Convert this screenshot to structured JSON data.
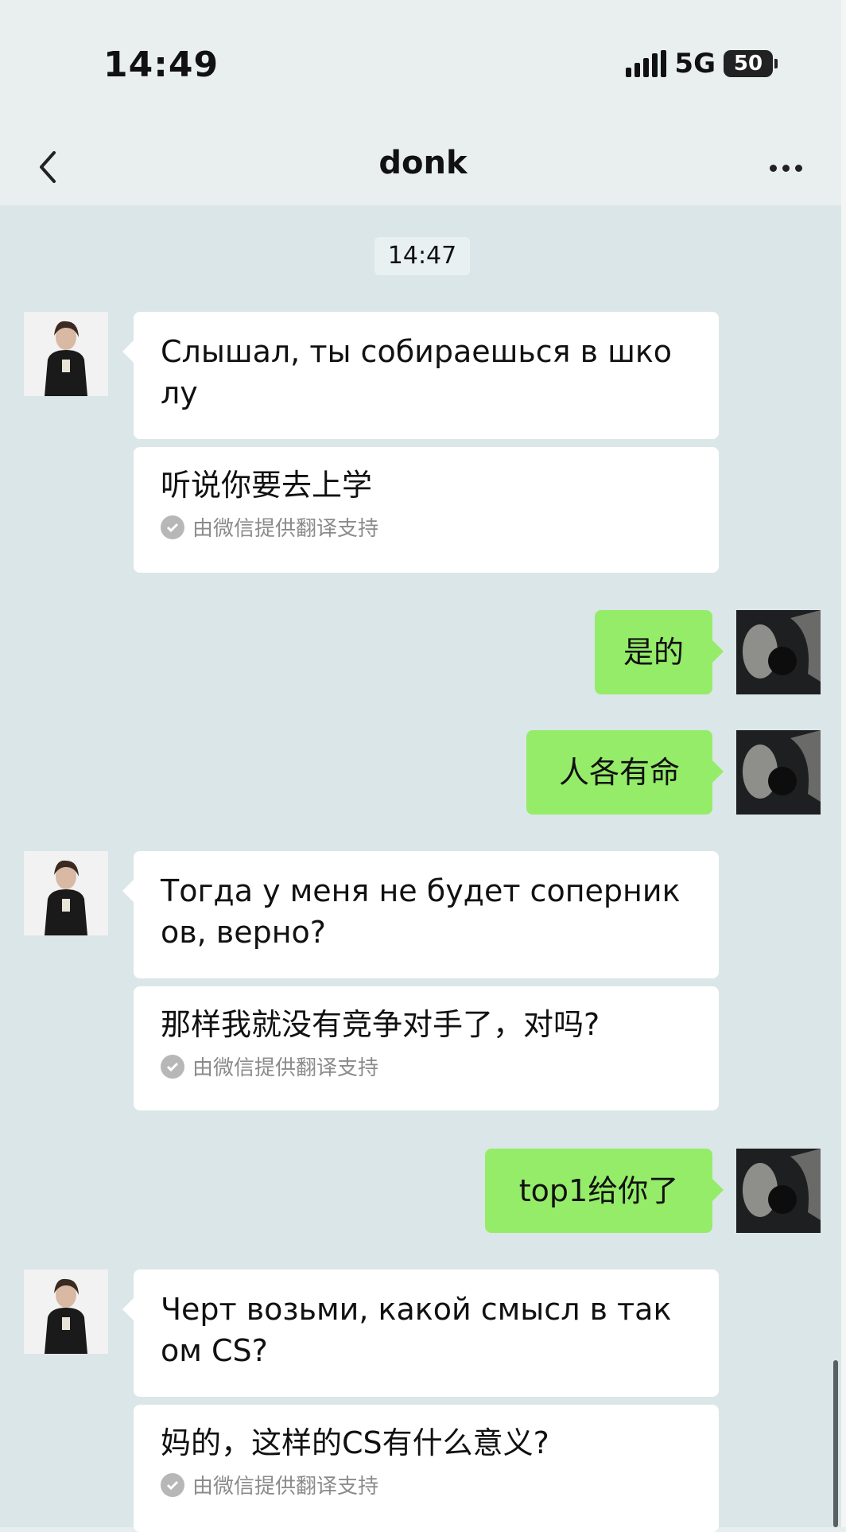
{
  "status_bar": {
    "time": "14:49",
    "network": "5G",
    "battery": "50"
  },
  "nav": {
    "title": "donk"
  },
  "chat": {
    "timestamp": "14:47",
    "translation_note": "由微信提供翻译支持",
    "messages": [
      {
        "from": "contact",
        "text": "Слышал, ты собираешься в шко лу",
        "translation": "听说你要去上学"
      },
      {
        "from": "me",
        "text": "是的"
      },
      {
        "from": "me",
        "text": "人各有命"
      },
      {
        "from": "contact",
        "text": "Тогда у меня не будет соперник ов, верно?",
        "translation": "那样我就没有竞争对手了，对吗?"
      },
      {
        "from": "me",
        "text": "top1给你了"
      },
      {
        "from": "contact",
        "text": "Черт возьми, какой смысл в так ом CS?",
        "translation": "妈的，这样的CS有什么意义?"
      }
    ]
  },
  "colors": {
    "bubble_out": "#95ec69",
    "bubble_in": "#ffffff",
    "chat_bg": "#dbe6e8"
  }
}
